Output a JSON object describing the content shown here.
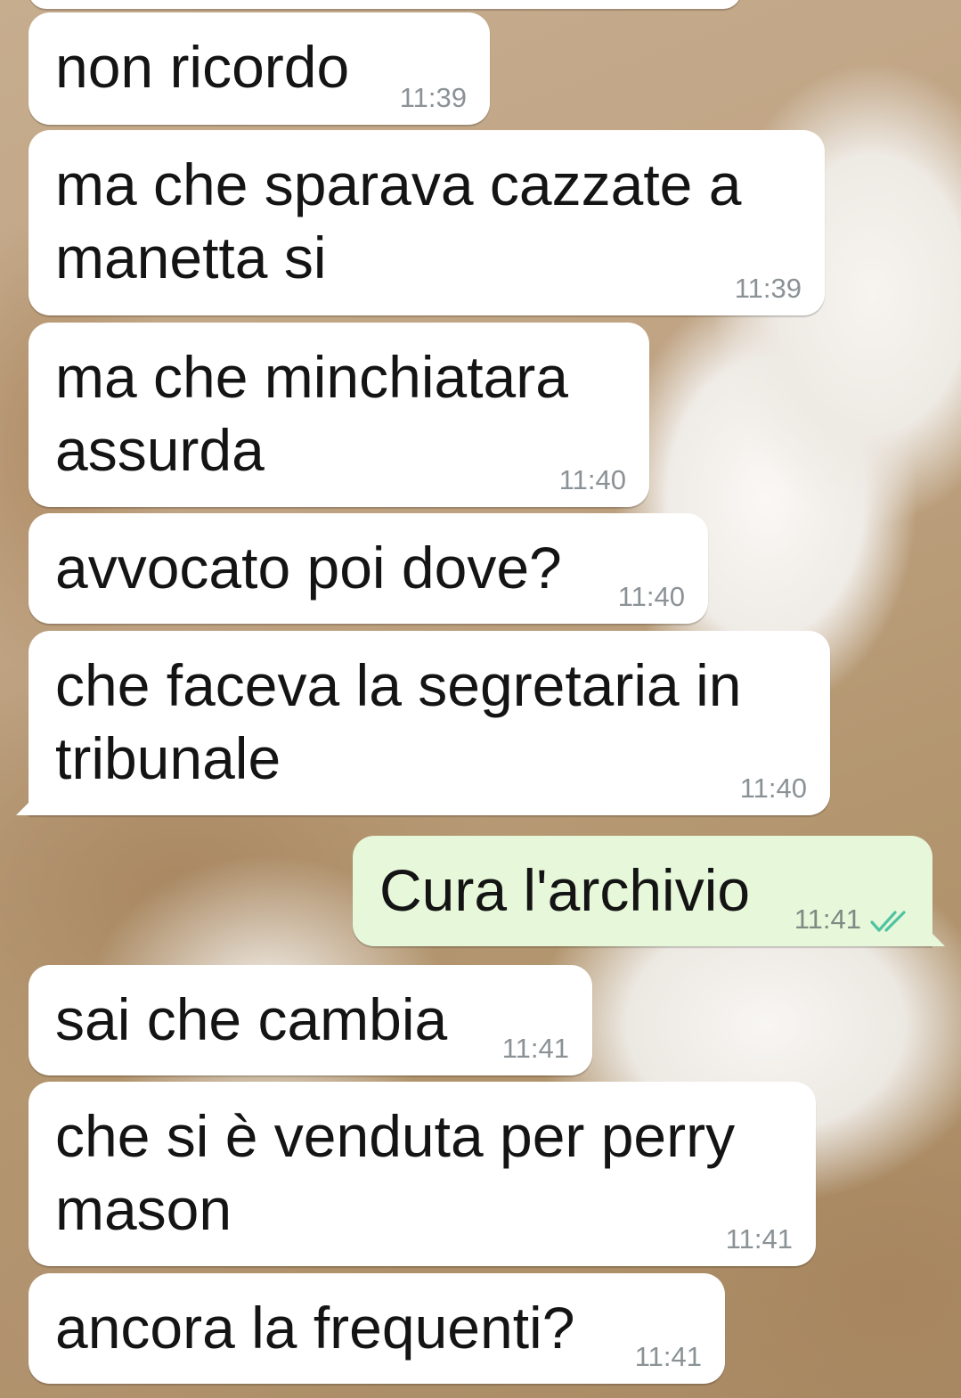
{
  "messages": [
    {
      "text": "non ricordo",
      "time": "11:39",
      "direction": "incoming"
    },
    {
      "text": "ma che sparava cazzate a\nmanetta si",
      "time": "11:39",
      "direction": "incoming"
    },
    {
      "text": "ma che minchiatara\nassurda",
      "time": "11:40",
      "direction": "incoming"
    },
    {
      "text": "avvocato poi dove?",
      "time": "11:40",
      "direction": "incoming"
    },
    {
      "text": "che faceva la segretaria in\ntribunale",
      "time": "11:40",
      "direction": "incoming"
    },
    {
      "text": "Cura l'archivio",
      "time": "11:41",
      "direction": "outgoing",
      "status_icon": "double-check-icon"
    },
    {
      "text": "sai che cambia",
      "time": "11:41",
      "direction": "incoming"
    },
    {
      "text": "che si è venduta per perry\nmason",
      "time": "11:41",
      "direction": "incoming"
    },
    {
      "text": "ancora la frequenti?",
      "time": "11:41",
      "direction": "incoming"
    }
  ],
  "colors": {
    "incoming_bubble": "#ffffff",
    "outgoing_bubble": "#e6f8d9",
    "read_ticks": "#4fc3a1",
    "timestamp": "#8b9296"
  }
}
